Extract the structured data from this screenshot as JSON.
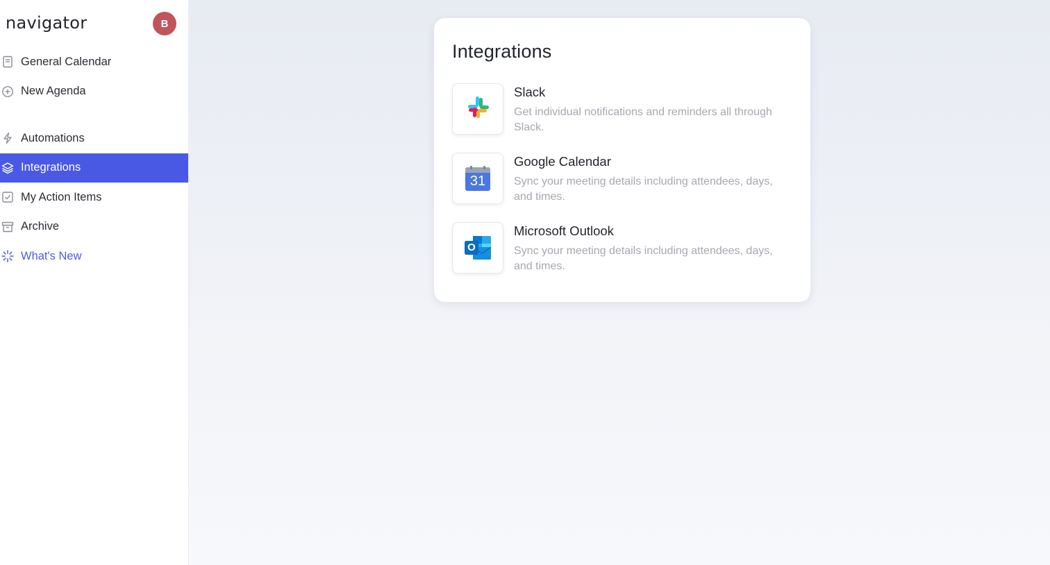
{
  "app": {
    "logo": "navigator",
    "avatar_initial": "B",
    "avatar_color": "#c0545a",
    "accent": "#4959e3"
  },
  "sidebar": {
    "items": [
      {
        "label": "General Calendar",
        "icon": "document-icon"
      },
      {
        "label": "New Agenda",
        "icon": "plus-circle-icon"
      },
      {
        "label": "Automations",
        "icon": "lightning-icon"
      },
      {
        "label": "Integrations",
        "icon": "layers-icon",
        "active": true
      },
      {
        "label": "My Action Items",
        "icon": "checkbox-icon"
      },
      {
        "label": "Archive",
        "icon": "archive-icon"
      },
      {
        "label": "What's New",
        "icon": "sparkle-icon"
      }
    ]
  },
  "main": {
    "card_title": "Integrations",
    "integrations": [
      {
        "name": "Slack",
        "description": "Get individual notifications and reminders all through Slack.",
        "icon": "slack-logo-icon"
      },
      {
        "name": "Google Calendar",
        "description": "Sync your meeting details including attendees, days, and times.",
        "icon": "google-calendar-icon",
        "badge": "31"
      },
      {
        "name": "Microsoft Outlook",
        "description": "Sync your meeting details including attendees, days, and times.",
        "icon": "outlook-icon",
        "badge": "O"
      }
    ]
  }
}
